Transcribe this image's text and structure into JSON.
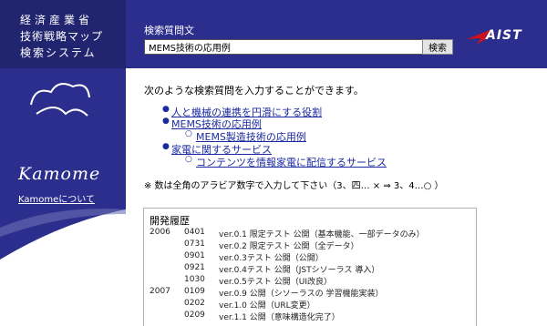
{
  "header": {
    "title_lines": [
      "経済産業省",
      "技術戦略マップ",
      "検索システム"
    ],
    "search_label": "検索質問文",
    "search_value": "MEMS技術の応用例",
    "search_button": "検索",
    "brand": "AIST"
  },
  "sidebar": {
    "logo_text": "Kamome",
    "about_link": "Kamomeについて"
  },
  "main": {
    "intro": "次のような検索質問を入力することができます。",
    "examples": [
      "人と機械の連携を円滑にする役割",
      "MEMS技術の応用例",
      "MEMS製造技術の応用例",
      "家電に関するサービス",
      "コンテンツを情報家電に配信するサービス"
    ],
    "note": "※ 数は全角のアラビア数字で入力して下さい（3、四… × ⇒ 3、4…○ ）"
  },
  "history": {
    "title": "開発履歴",
    "rows": [
      {
        "year": "2006",
        "date": "0401",
        "desc": "ver.0.1 限定テスト 公開（基本機能、一部データのみ）"
      },
      {
        "year": "",
        "date": "0731",
        "desc": "ver.0.2 限定テスト 公開（全データ）"
      },
      {
        "year": "",
        "date": "0901",
        "desc": "ver.0.3テスト 公開（公開）"
      },
      {
        "year": "",
        "date": "0921",
        "desc": "ver.0.4テスト 公開（JSTシソーラス 導入）"
      },
      {
        "year": "",
        "date": "1030",
        "desc": "ver.0.5テスト 公開（UI改良）"
      },
      {
        "year": "2007",
        "date": "0109",
        "desc": "ver.0.9 公開（シソーラスの 学習機能実装）"
      },
      {
        "year": "",
        "date": "0202",
        "desc": "ver.1.0 公開（URL変更）"
      },
      {
        "year": "",
        "date": "0209",
        "desc": "ver.1.1 公開（意味構造化完了）"
      }
    ]
  },
  "colors": {
    "header_bg": "#2b2e8c",
    "header_left_bg": "#21246f",
    "link": "#1b2aa0",
    "brand_red": "#d0101a"
  }
}
